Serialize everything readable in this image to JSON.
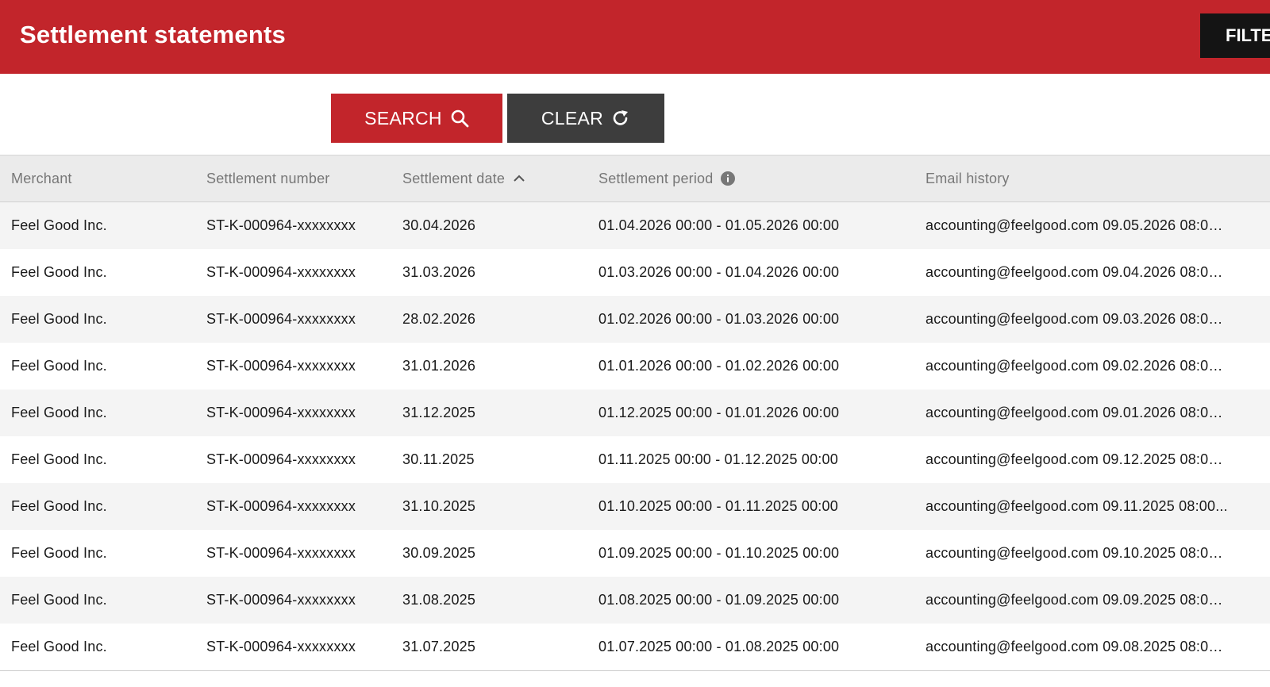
{
  "header": {
    "title": "Settlement statements",
    "button_label": "FILTER"
  },
  "toolbar": {
    "search_label": "SEARCH",
    "clear_label": "CLEAR",
    "search_icon": "search-icon",
    "clear_icon": "refresh-icon"
  },
  "table": {
    "columns": [
      "Merchant",
      "Settlement number",
      "Settlement date",
      "Settlement period",
      "Email history"
    ],
    "rows": [
      [
        "Feel Good Inc.",
        "ST-K-000964-xxxxxxxx",
        "30.04.2026",
        "01.04.2026 00:00 - 01.05.2026 00:00",
        "accounting@feelgood.com 09.05.2026 08:00..."
      ],
      [
        "Feel Good Inc.",
        "ST-K-000964-xxxxxxxx",
        "31.03.2026",
        "01.03.2026 00:00 - 01.04.2026 00:00",
        "accounting@feelgood.com 09.04.2026 08:00..."
      ],
      [
        "Feel Good Inc.",
        "ST-K-000964-xxxxxxxx",
        "28.02.2026",
        "01.02.2026 00:00 - 01.03.2026 00:00",
        "accounting@feelgood.com 09.03.2026 08:00..."
      ],
      [
        "Feel Good Inc.",
        "ST-K-000964-xxxxxxxx",
        "31.01.2026",
        "01.01.2026 00:00 - 01.02.2026 00:00",
        "accounting@feelgood.com 09.02.2026 08:00..."
      ],
      [
        "Feel Good Inc.",
        "ST-K-000964-xxxxxxxx",
        "31.12.2025",
        "01.12.2025 00:00 - 01.01.2026 00:00",
        "accounting@feelgood.com 09.01.2026 08:00..."
      ],
      [
        "Feel Good Inc.",
        "ST-K-000964-xxxxxxxx",
        "30.11.2025",
        "01.11.2025 00:00 - 01.12.2025 00:00",
        "accounting@feelgood.com 09.12.2025 08:00..."
      ],
      [
        "Feel Good Inc.",
        "ST-K-000964-xxxxxxxx",
        "31.10.2025",
        "01.10.2025 00:00 - 01.11.2025 00:00",
        "accounting@feelgood.com 09.11.2025 08:00..."
      ],
      [
        "Feel Good Inc.",
        "ST-K-000964-xxxxxxxx",
        "30.09.2025",
        "01.09.2025 00:00 - 01.10.2025 00:00",
        "accounting@feelgood.com 09.10.2025 08:00..."
      ],
      [
        "Feel Good Inc.",
        "ST-K-000964-xxxxxxxx",
        "31.08.2025",
        "01.08.2025 00:00 - 01.09.2025 00:00",
        "accounting@feelgood.com 09.09.2025 08:00..."
      ],
      [
        "Feel Good Inc.",
        "ST-K-000964-xxxxxxxx",
        "31.07.2025",
        "01.07.2025 00:00 - 01.08.2025 00:00",
        "accounting@feelgood.com 09.08.2025 08:00..."
      ]
    ]
  },
  "colors": {
    "brand": "#c2252b",
    "clear_button": "#3d3d3d",
    "header_button": "#141414"
  }
}
